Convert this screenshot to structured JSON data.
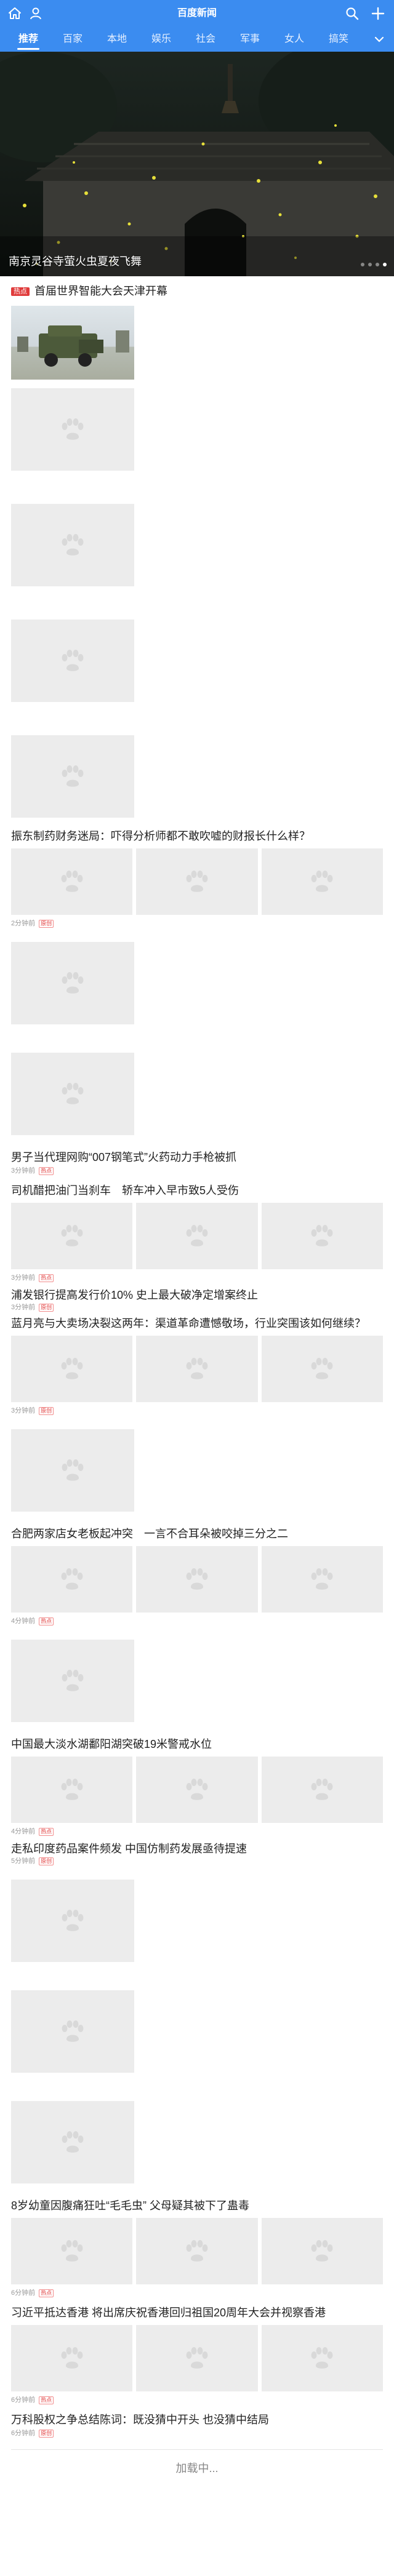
{
  "header": {
    "logo_text": "百度新闻",
    "icons": [
      "home-icon",
      "user-icon",
      "search-icon",
      "plus-icon"
    ]
  },
  "nav": {
    "tabs": [
      "推荐",
      "百家",
      "本地",
      "娱乐",
      "社会",
      "军事",
      "女人",
      "搞笑"
    ],
    "active_index": 0
  },
  "hero": {
    "caption": "南京灵谷寺萤火虫夏夜飞舞",
    "slide_count": 4,
    "active_slide": 3
  },
  "feed": {
    "items": [
      {
        "hot_tag": "热点",
        "title": "首届世界智能大会天津开幕"
      },
      {
        "title": "振东制药财务迷局：吓得分析师都不敢吹嘘的财报长什么样？",
        "meta": "2分钟前",
        "badge": "原创"
      },
      {
        "title": "男子当代理网购“007钢笔式”火药动力手枪被抓",
        "meta": "3分钟前",
        "badge": "热点"
      },
      {
        "title": "司机醋把油门当刹车　轿车冲入早市致5人受伤",
        "meta": "3分钟前",
        "badge": "热点"
      },
      {
        "title": "浦发银行提高发行价10% 史上最大破净定增案终止",
        "meta": "3分钟前",
        "badge": "原创"
      },
      {
        "title": "蓝月亮与大卖场决裂这两年：渠道革命遭憾敬场，行业突围该如何继续？",
        "meta": "3分钟前",
        "badge": "原创"
      },
      {
        "title": "合肥两家店女老板起冲突　一言不合耳朵被咬掉三分之二",
        "meta": "4分钟前",
        "badge": "热点"
      },
      {
        "title": "中国最大淡水湖鄱阳湖突破19米警戒水位",
        "meta": "4分钟前",
        "badge": "热点"
      },
      {
        "title": "走私印度药品案件频发 中国仿制药发展亟待提速",
        "meta": "5分钟前",
        "badge": "原创"
      },
      {
        "title": "8岁幼童因腹痛狂吐“毛毛虫” 父母疑其被下了蛊毒",
        "meta": "6分钟前",
        "badge": "热点"
      },
      {
        "title": "习近平抵达香港 将出席庆祝香港回归祖国20周年大会并视察香港",
        "meta": "6分钟前",
        "badge": "热点"
      },
      {
        "title": "万科股权之争总结陈词：既没猜中开头 也没猜中结局",
        "meta": "6分钟前",
        "badge": "原创"
      }
    ],
    "loading_text": "加载中..."
  },
  "colors": {
    "brand_blue": "#3b8cf0",
    "hot_red": "#e03b3b",
    "placeholder_gray": "#ececec"
  }
}
